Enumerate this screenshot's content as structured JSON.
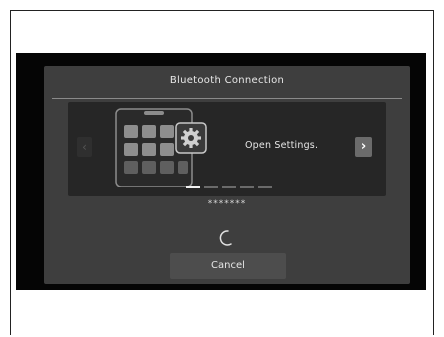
{
  "dialog": {
    "title": "Bluetooth Connection",
    "instruction": "Open Settings.",
    "passkey": "*******",
    "cancel_label": "Cancel",
    "nav": {
      "prev_icon": "chevron-left-icon",
      "next_icon": "chevron-right-icon",
      "prev_glyph": "‹",
      "next_glyph": "›"
    },
    "pager": {
      "total": 5,
      "current": 1
    }
  },
  "colors": {
    "background": "#050505",
    "dialog": "#3e3e3e",
    "card": "#262626",
    "text": "#e6e6e6"
  }
}
